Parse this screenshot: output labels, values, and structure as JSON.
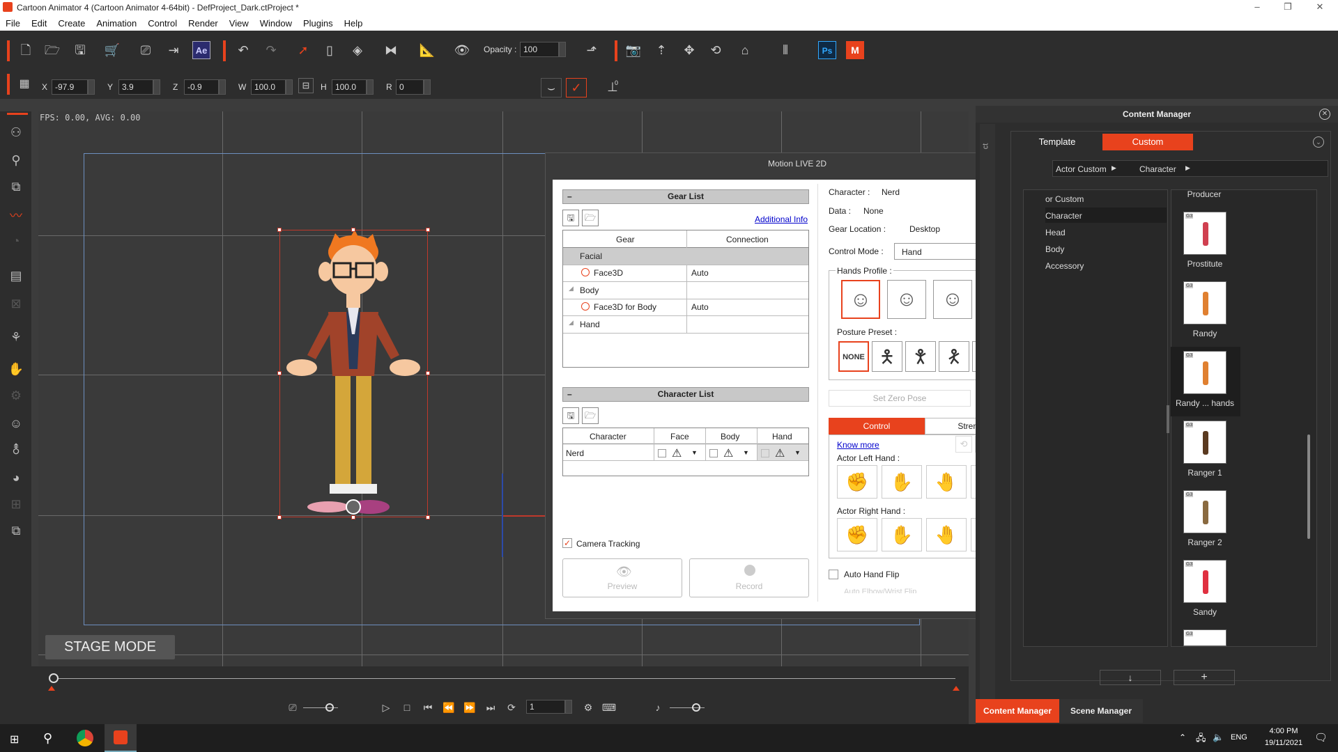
{
  "window": {
    "title": "Cartoon Animator 4  (Cartoon Animator 4-64bit) - DefProject_Dark.ctProject *",
    "controls": [
      "–",
      "❐",
      "✕"
    ]
  },
  "menu": [
    "File",
    "Edit",
    "Create",
    "Animation",
    "Control",
    "Render",
    "View",
    "Window",
    "Plugins",
    "Help"
  ],
  "toolbar": {
    "opacity_label": "Opacity :",
    "opacity_value": "100",
    "ae_label": "Ae",
    "ps_label": "Ps",
    "m_label": "M"
  },
  "transform": {
    "x_label": "X",
    "x_value": "-97.9",
    "y_label": "Y",
    "y_value": "3.9",
    "z_label": "Z",
    "z_value": "-0.9",
    "w_label": "W",
    "w_value": "100.0",
    "h_label": "H",
    "h_value": "100.0",
    "r_label": "R",
    "r_value": "0",
    "zero_mark": "0"
  },
  "stage": {
    "fps": "FPS: 0.00, AVG: 0.00",
    "mode_label": "STAGE MODE"
  },
  "timeline": {
    "frame": "1"
  },
  "motion_live": {
    "title": "Motion LIVE 2D",
    "gear_list_title": "Gear List",
    "additional_info": "Additional Info",
    "gear_headers": [
      "Gear",
      "Connection"
    ],
    "gear_rows": [
      {
        "name": "Facial",
        "connection": "",
        "type": "group-selected"
      },
      {
        "name": "Face3D",
        "connection": "Auto",
        "type": "device"
      },
      {
        "name": "Body",
        "connection": "",
        "type": "group"
      },
      {
        "name": "Face3D for Body",
        "connection": "Auto",
        "type": "device"
      },
      {
        "name": "Hand",
        "connection": "",
        "type": "group"
      }
    ],
    "character_list_title": "Character List",
    "char_headers": [
      "Character",
      "Face",
      "Body",
      "Hand"
    ],
    "char_row": {
      "name": "Nerd"
    },
    "camera_tracking": "Camera Tracking",
    "preview": "Preview",
    "record": "Record",
    "character_label": "Character :",
    "character_value": "Nerd",
    "data_label": "Data :",
    "data_value": "None",
    "gear_location_label": "Gear Location :",
    "gear_location_value": "Desktop",
    "control_mode_label": "Control Mode :",
    "control_mode_value": "Hand",
    "hands_profile": "Hands Profile :",
    "posture_preset": "Posture Preset :",
    "none_label": "NONE",
    "set_zero_pose": "Set Zero Pose",
    "tab_control": "Control",
    "tab_strength": "Strength",
    "know_more": "Know more",
    "left_hand": "Actor Left Hand :",
    "right_hand": "Actor Right Hand :",
    "auto_hand_flip": "Auto Hand Flip",
    "auto_elbow": "Auto Elbow/Wrist Flip"
  },
  "content_manager": {
    "title": "Content Manager",
    "tab_template": "Template",
    "tab_custom": "Custom",
    "breadcrumb": [
      "Actor Custom",
      "Character"
    ],
    "side_tab": "ct",
    "tree": [
      "or Custom",
      "Character",
      "Head",
      "Body",
      "Accessory"
    ],
    "top_label": "Producer",
    "items": [
      "Prostitute",
      "Randy",
      "Randy ... hands",
      "Ranger 1",
      "Ranger 2",
      "Sandy"
    ],
    "g3": "G3",
    "bottom_tabs": [
      "Content Manager",
      "Scene Manager"
    ],
    "down_btn": "↓",
    "add_btn": "+"
  },
  "taskbar": {
    "lang": "ENG",
    "time": "4:00 PM",
    "date": "19/11/2021"
  },
  "colors": {
    "accent": "#e8421d"
  }
}
